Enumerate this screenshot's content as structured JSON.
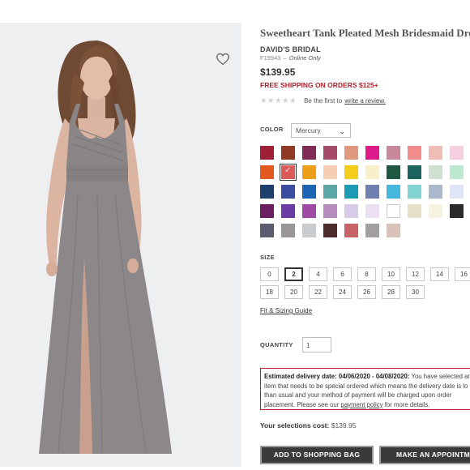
{
  "product": {
    "title": "Sweetheart Tank Pleated Mesh Bridesmaid Dress",
    "brand": "DAVID'S BRIDAL",
    "sku": "F19943",
    "availability": "Online Only",
    "price": "$139.95",
    "shipping_promo": "FREE SHIPPING ON ORDERS $125+",
    "review_prompt": "Be the first to",
    "review_link": "write a review.",
    "rating_stars": 0
  },
  "image": {
    "wishlist_icon": "heart-outline-icon",
    "background": "#eeeff1",
    "dress_color": "#8c8889"
  },
  "color": {
    "label": "COLOR",
    "selected": "Mercury",
    "swatches": [
      [
        "#9e1f36",
        "#8f3a22",
        "#7f2b55",
        "#a5486a",
        "#e0987f",
        "#dc1a8a",
        "#c9879a",
        "#f28c8a",
        "#efbdb5",
        "#f6cfe0"
      ],
      [
        "#e25a1e",
        "#dc5a58",
        "#ee9f1a",
        "#f5cdb3",
        "#f4cc1c",
        "#f8f0c8",
        "#1e5840",
        "#1b6460",
        "#cfe0d3",
        "#bde8cf"
      ],
      [
        "#1f3f6c",
        "#3a4da0",
        "#1c64b4",
        "#5aa6a8",
        "#1d9ab4",
        "#6f7fb0",
        "#47b6dc",
        "#82d3d3",
        "#aab8cc",
        "#dee6f6"
      ],
      [
        "#6a2060",
        "#6a3ca4",
        "#9f4aa4",
        "#b68bbe",
        "#d6cce8",
        "#eae0f2",
        "#ffffff",
        "#e6e0c6",
        "#f6f2e0",
        "#2b2b2b"
      ],
      [
        "#5a5d70",
        "#9a9698",
        "#c9cbcc",
        "#4c2c2c",
        "#c76468",
        "#a39ea2",
        "#d9c2b8"
      ]
    ],
    "selected_index": 11
  },
  "size": {
    "label": "SIZE",
    "options": [
      "0",
      "2",
      "4",
      "6",
      "8",
      "10",
      "12",
      "14",
      "16",
      "18",
      "20",
      "22",
      "24",
      "26",
      "28",
      "30"
    ],
    "selected": "2",
    "fit_guide": "Fit & Sizing Guide"
  },
  "quantity": {
    "label": "QUANTITY",
    "value": "1"
  },
  "delivery": {
    "heading": "Estimated delivery date: 04/06/2020 - 04/08/2020:",
    "line1": "You have selected an",
    "line2": "item that needs to be special ordered which means the delivery date is lo",
    "line3": "than usual and your method of payment will be charged upon order",
    "line4_prefix": "placement. Please see our",
    "policy_link": "payment policy",
    "line4_suffix": "for more details."
  },
  "summary": {
    "label": "Your selections cost:",
    "value": "$139.95"
  },
  "buttons": {
    "add_to_bag": "ADD TO SHOPPING BAG",
    "appointment": "MAKE AN APPOINTMENT"
  }
}
